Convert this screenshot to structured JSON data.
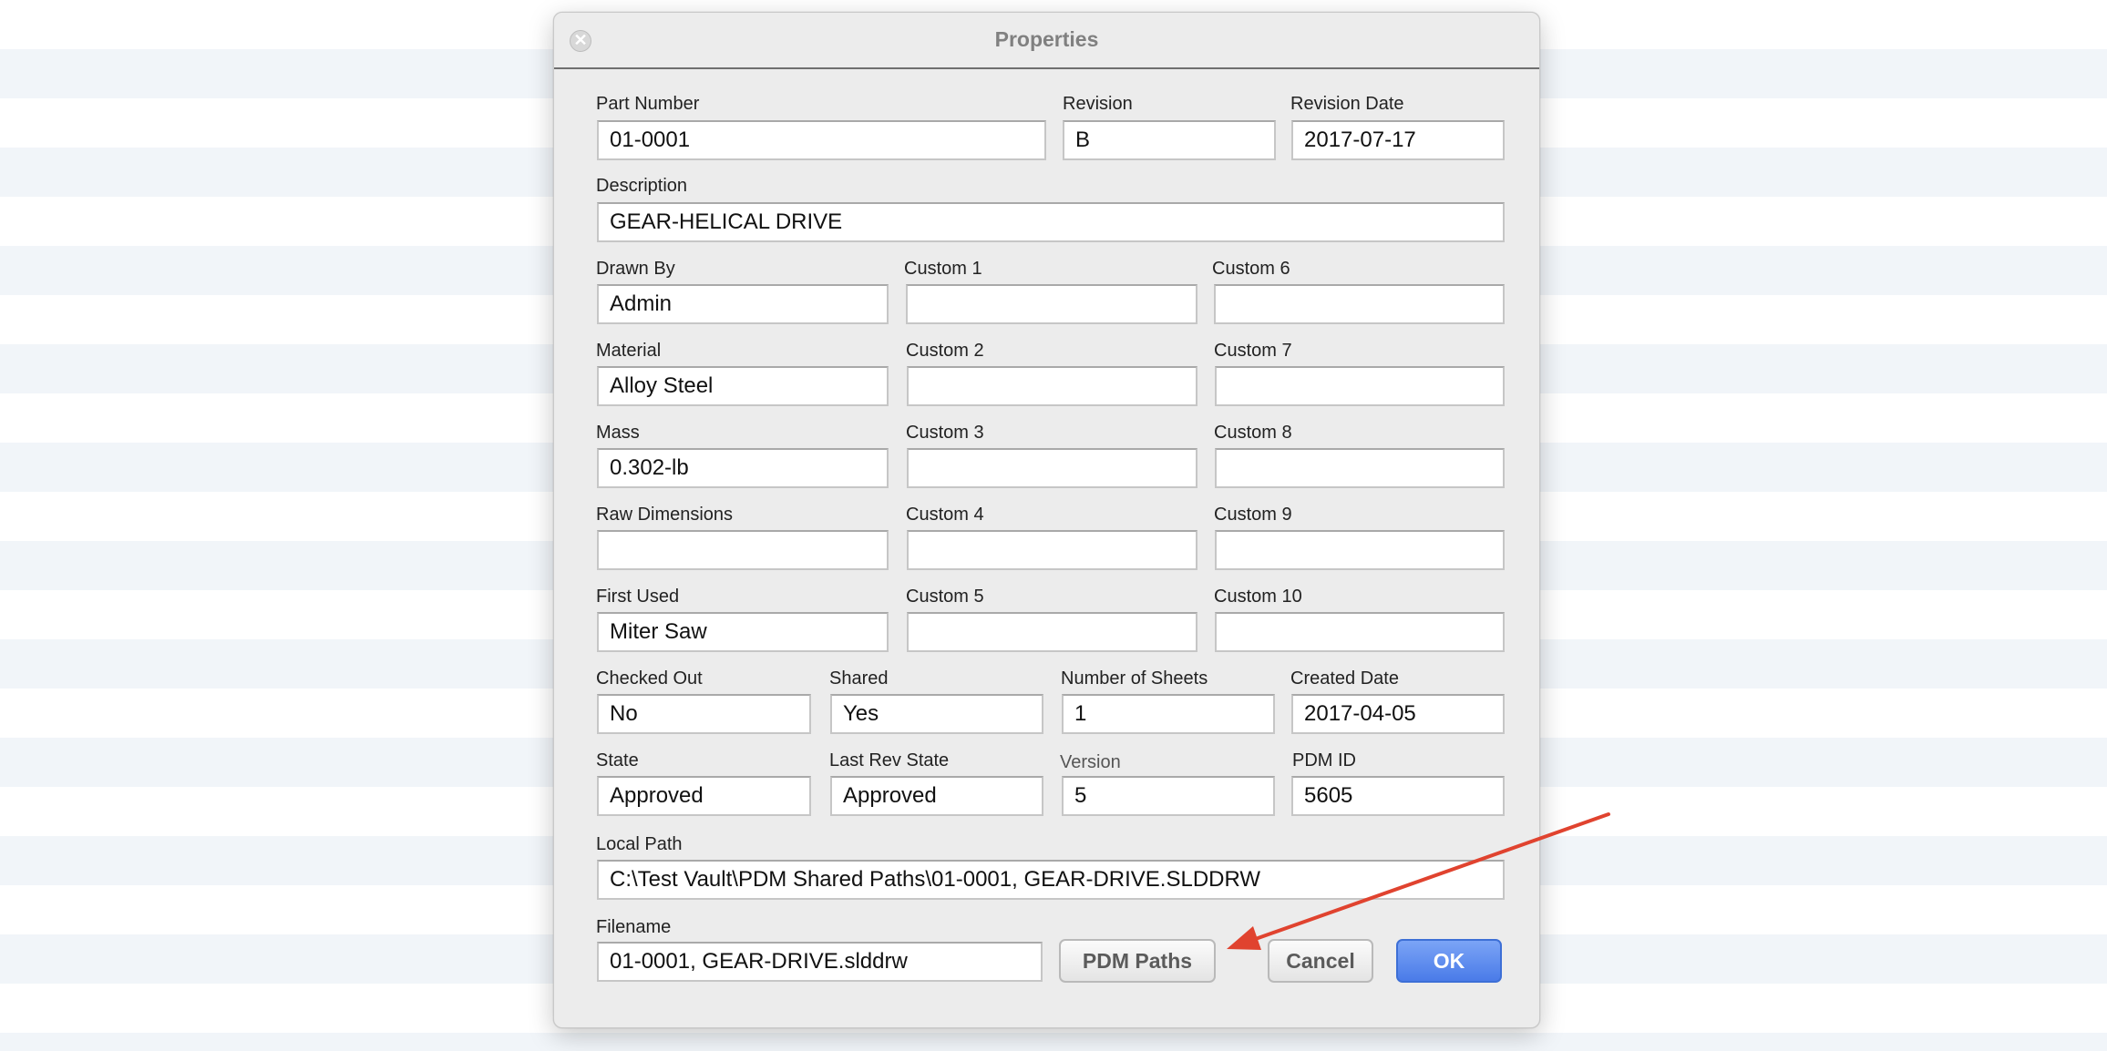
{
  "dialog": {
    "title": "Properties",
    "close_glyph": "✕"
  },
  "fields": {
    "part_number": {
      "label": "Part Number",
      "value": "01-0001"
    },
    "revision": {
      "label": "Revision",
      "value": "B"
    },
    "revision_date": {
      "label": "Revision Date",
      "value": "2017-07-17"
    },
    "description": {
      "label": "Description",
      "value": "GEAR-HELICAL DRIVE"
    },
    "drawn_by": {
      "label": "Drawn By",
      "value": "Admin"
    },
    "material": {
      "label": "Material",
      "value": "Alloy Steel"
    },
    "mass": {
      "label": "Mass",
      "value": "0.302-lb"
    },
    "raw_dimensions": {
      "label": "Raw Dimensions",
      "value": ""
    },
    "first_used": {
      "label": "First Used",
      "value": "Miter Saw"
    },
    "custom1": {
      "label": "Custom 1",
      "value": ""
    },
    "custom2": {
      "label": "Custom 2",
      "value": ""
    },
    "custom3": {
      "label": "Custom 3",
      "value": ""
    },
    "custom4": {
      "label": "Custom 4",
      "value": ""
    },
    "custom5": {
      "label": "Custom 5",
      "value": ""
    },
    "custom6": {
      "label": "Custom 6",
      "value": ""
    },
    "custom7": {
      "label": "Custom 7",
      "value": ""
    },
    "custom8": {
      "label": "Custom 8",
      "value": ""
    },
    "custom9": {
      "label": "Custom 9",
      "value": ""
    },
    "custom10": {
      "label": "Custom 10",
      "value": ""
    },
    "checked_out": {
      "label": "Checked Out",
      "value": "No"
    },
    "shared": {
      "label": "Shared",
      "value": "Yes"
    },
    "number_of_sheets": {
      "label": "Number of Sheets",
      "value": "1"
    },
    "created_date": {
      "label": "Created Date",
      "value": "2017-04-05"
    },
    "state": {
      "label": "State",
      "value": "Approved"
    },
    "last_rev_state": {
      "label": "Last Rev State",
      "value": "Approved"
    },
    "version": {
      "label": "Version",
      "value": "5"
    },
    "pdm_id": {
      "label": "PDM ID",
      "value": "5605"
    },
    "local_path": {
      "label": "Local Path",
      "value": "C:\\Test Vault\\PDM Shared Paths\\01-0001, GEAR-DRIVE.SLDDRW"
    },
    "filename": {
      "label": "Filename",
      "value": "01-0001, GEAR-DRIVE.slddrw"
    }
  },
  "buttons": {
    "pdm_paths": "PDM Paths",
    "cancel": "Cancel",
    "ok": "OK"
  },
  "colors": {
    "ok_button": "#4a7be8",
    "annotation_arrow": "#e0432f",
    "background_stripe": "#f1f5f9"
  },
  "icons": {
    "close": "close-icon",
    "annotation": "red-arrow-annotation"
  }
}
